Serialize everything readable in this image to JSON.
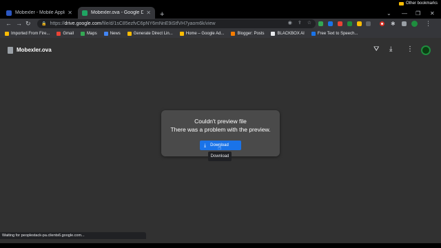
{
  "tabs": [
    {
      "title": "Mobexler - Mobile Application P",
      "favicon_color": "#2b57c2"
    },
    {
      "title": "Mobexler.ova - Google Drive",
      "favicon_color": "#1fa463"
    }
  ],
  "toolbar": {
    "url_host": "drive.google.com",
    "url_path": "/file/d/1sC85ezfvC6pNY6mNnE9iStfVH7yaom6k/view"
  },
  "extension_colors": [
    "#34a853",
    "#1a73e8",
    "#ea4335",
    "#1e8e3e",
    "#fbbc04"
  ],
  "bookmarks": [
    {
      "label": "Imported From Fire...",
      "icon_color": "#fbbc04"
    },
    {
      "label": "Gmail",
      "icon_color": "#ea4335"
    },
    {
      "label": "Maps",
      "icon_color": "#34a853"
    },
    {
      "label": "News",
      "icon_color": "#4285f4"
    },
    {
      "label": "Generate Direct Lin...",
      "icon_color": "#fbbc04"
    },
    {
      "label": "Home – Google Ad...",
      "icon_color": "#fbbc04"
    },
    {
      "label": "Blogger: Posts",
      "icon_color": "#f57c00"
    },
    {
      "label": "BLACKBOX AI",
      "icon_color": "#e8eaed"
    },
    {
      "label": "Free Text to Speech...",
      "icon_color": "#1a73e8"
    }
  ],
  "other_bookmarks": "Other bookmarks",
  "viewer": {
    "file_name": "Mobexler.ova",
    "error_title": "Couldn't preview file",
    "error_detail": "There was a problem with the preview.",
    "download_label": "Download",
    "tooltip": "Download"
  },
  "status_text": "Waiting for peoplestack-pa.clients6.google.com..."
}
